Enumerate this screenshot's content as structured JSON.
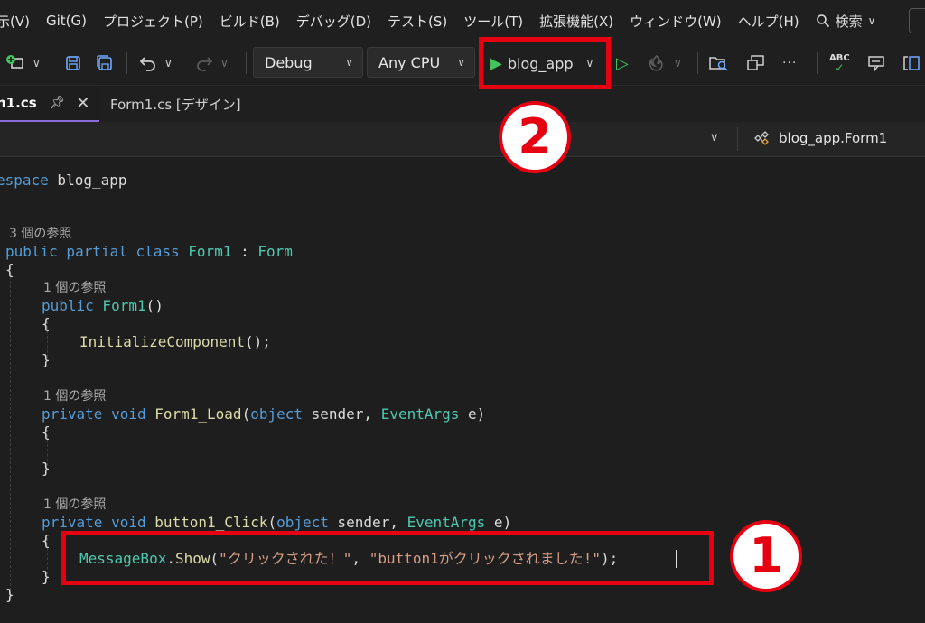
{
  "menu": {
    "items": [
      "示(V)",
      "Git(G)",
      "プロジェクト(P)",
      "ビルド(B)",
      "デバッグ(D)",
      "テスト(S)",
      "ツール(T)",
      "拡張機能(X)",
      "ウィンドウ(W)",
      "ヘルプ(H)"
    ],
    "search_label": "検索",
    "search_chevron": "∨"
  },
  "toolbar": {
    "config": "Debug",
    "platform": "Any CPU",
    "start_project": "blog_app",
    "more": "···",
    "spell": "ABC"
  },
  "tabs": [
    {
      "label": "n1.cs",
      "active": true
    },
    {
      "label": "Form1.cs [デザイン]",
      "active": false
    }
  ],
  "navbar": {
    "class_name": "blog_app.Form1"
  },
  "code": {
    "namespace_kw": "espace",
    "namespace_name": " blog_app",
    "ref3": "3 個の参照",
    "ref1": "1 個の参照",
    "class_decl": {
      "kw": "public partial class",
      "name": " Form1",
      "sep": " : ",
      "base": "Form"
    },
    "brace_open": "{",
    "brace_close": "}",
    "ctor": {
      "kw": "public",
      "name": " Form1",
      "rest": "()"
    },
    "init_call": {
      "name": "InitializeComponent",
      "rest": "();"
    },
    "load": {
      "kw": "private void",
      "name": " Form1_Load",
      "p1": "(",
      "t1": "object",
      "a1": " sender, ",
      "t2": "EventArgs",
      "a2": " e)"
    },
    "click": {
      "kw": "private void",
      "name": " button1_Click",
      "p1": "(",
      "t1": "object",
      "a1": " sender, ",
      "t2": "EventArgs",
      "a2": " e)"
    },
    "msg": {
      "type": "MessageBox",
      "dot": ".",
      "method": "Show",
      "open": "(",
      "s1": "\"クリックされた！\"",
      "comma": ", ",
      "s2": "\"button1がクリックされました!\"",
      "close": ");"
    }
  },
  "annotations": {
    "badge1": "1",
    "badge2": "2"
  },
  "colors": {
    "accent_red": "#e60012",
    "play_green": "#43c35e",
    "tab_underline": "#8a6cdb"
  }
}
